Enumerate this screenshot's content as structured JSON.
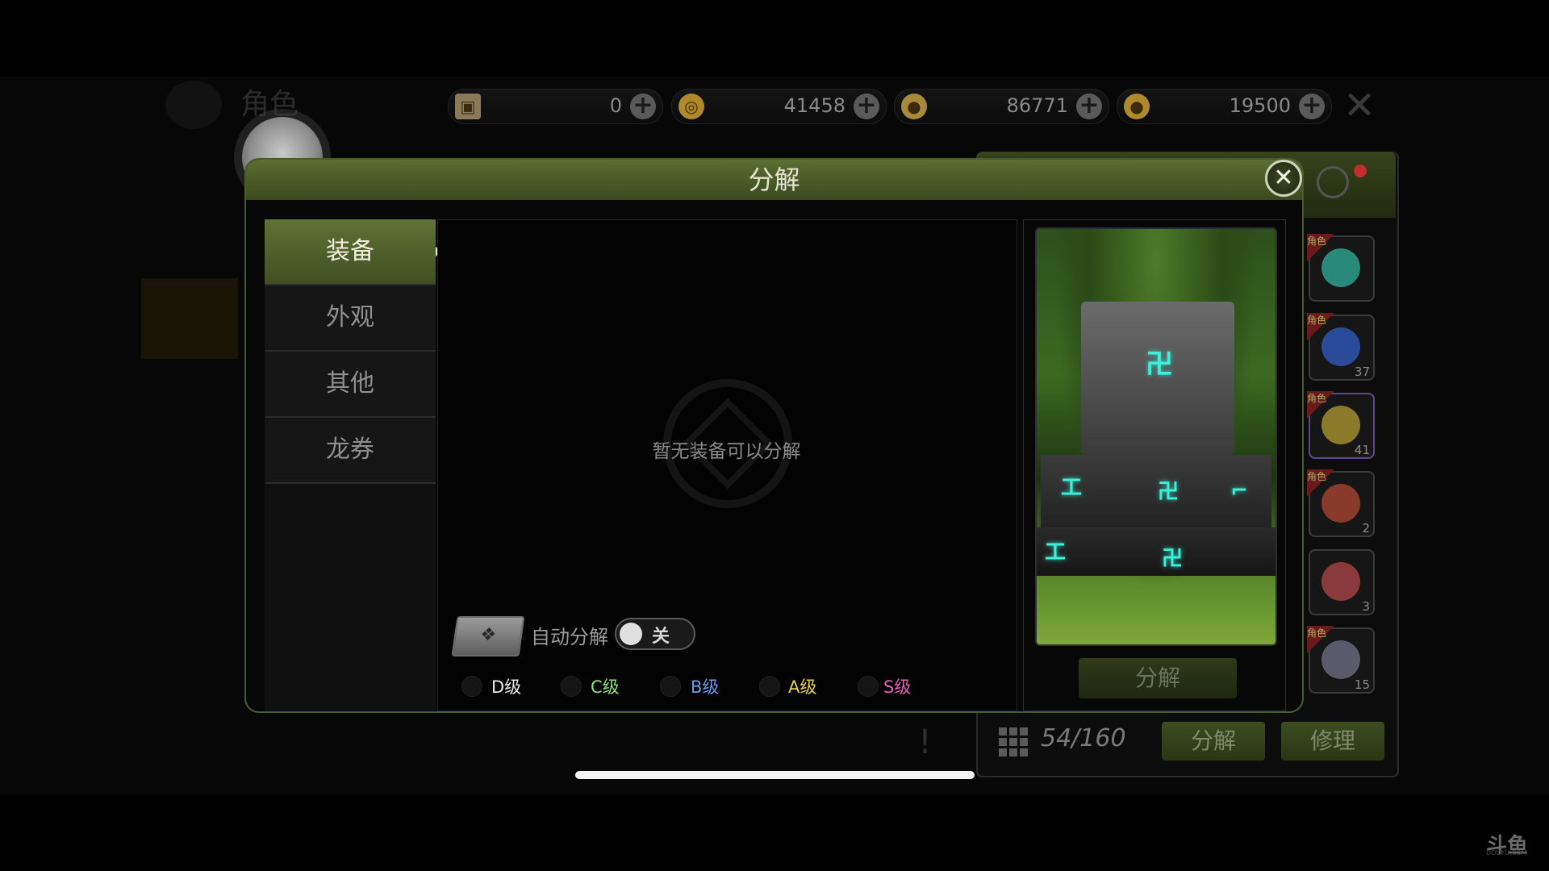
{
  "background": {
    "title": "角色",
    "bag_count": "54/160",
    "decompose_label": "分解",
    "repair_label": "修理",
    "slots": [
      {
        "badge": "角色",
        "count": "",
        "color": "#2a8a7a"
      },
      {
        "badge": "角色",
        "count": "37",
        "color": "#2a4a9a"
      },
      {
        "badge": "角色",
        "count": "41",
        "color": "#8a7a2a"
      },
      {
        "badge": "角色",
        "count": "2",
        "color": "#8a3a2a"
      },
      {
        "badge": "",
        "count": "3",
        "color": "#8a3a3a"
      },
      {
        "badge": "角色",
        "count": "15",
        "color": "#5a5a6a"
      }
    ]
  },
  "currencies": [
    {
      "icon": "card-icon",
      "value": "0",
      "color": "#8a7a5a"
    },
    {
      "icon": "ring-icon",
      "value": "41458",
      "color": "#b0892a"
    },
    {
      "icon": "lock-coin-icon",
      "value": "86771",
      "color": "#a88a3a"
    },
    {
      "icon": "coin-icon",
      "value": "19500",
      "color": "#b08a2a"
    }
  ],
  "dialog": {
    "title": "分解",
    "close": "✕",
    "tabs": [
      "装备",
      "外观",
      "其他",
      "龙券"
    ],
    "active_tab": 0,
    "empty_text": "暂无装备可以分解",
    "auto_label": "自动分解",
    "toggle_state": "关",
    "grades": [
      {
        "label": "D级",
        "color": "#e8e8e8"
      },
      {
        "label": "C级",
        "color": "#8ee07a"
      },
      {
        "label": "B级",
        "color": "#6a9ae8"
      },
      {
        "label": "A级",
        "color": "#e8d050"
      },
      {
        "label": "S级",
        "color": "#e060b8"
      }
    ],
    "decompose_button": "分解"
  },
  "watermark": {
    "line1": "斗鱼",
    "line2": "DOUYU.COM"
  },
  "colors": {
    "accent": "#5b6e33",
    "accent_dark": "#3b4a1e"
  }
}
